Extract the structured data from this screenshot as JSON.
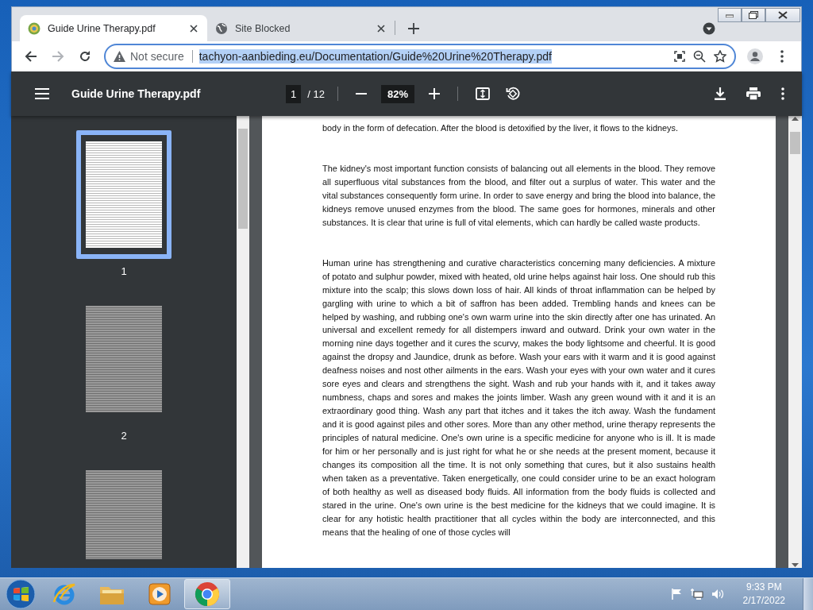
{
  "browser": {
    "tabs": [
      {
        "title": "Guide Urine Therapy.pdf",
        "selected": true
      },
      {
        "title": "Site Blocked",
        "selected": false
      }
    ],
    "address_bar": {
      "security": "Not secure",
      "url": "tachyon-aanbieding.eu/Documentation/Guide%20Urine%20Therapy.pdf",
      "url_selected": true
    }
  },
  "pdf_viewer": {
    "title": "Guide Urine Therapy.pdf",
    "page": "1",
    "page_count": "/ 12",
    "zoom": "82%",
    "thumbnails": [
      {
        "label": "1",
        "selected": true
      },
      {
        "label": "2",
        "selected": false
      },
      {
        "selected": false
      }
    ],
    "paragraphs": [
      "body in the form of defecation. After the blood is detoxified by the liver, it flows to the kidneys.",
      "The kidney's most important function consists of balancing out all elements in the blood. They remove all superfluous vital substances from the blood, and filter out a surplus of water. This water and the vital substances consequently form urine. In order to save energy and bring the blood into balance, the kidneys remove unused enzymes from the blood. The same goes for hormones, minerals and other substances. It is clear that urine is full of vital elements, which can hardly be called waste products.",
      "Human urine has strengthening and curative characteristics concerning many deficiencies. A mixture of potato and sulphur powder, mixed with heated, old urine helps against hair loss. One should rub this mixture into the scalp; this slows down loss of hair. All kinds of throat inflammation can be helped by gargling with urine to which a bit of saffron has been added. Trembling hands and knees can be helped by washing, and rubbing one's own warm urine into the skin directly after one has urinated. An universal and excellent remedy for all distempers inward and outward. Drink your own water in the morning nine days together and it cures the scurvy, makes the body lightsome and cheerful. It is good against the dropsy and Jaundice, drunk as before. Wash your ears with it warm and it is good against deafness noises and nost other ailments in the ears. Wash your eyes with your own water and it cures sore eyes and clears and strengthens the sight. Wash and rub your hands with it, and it takes away numbness, chaps and sores and makes the joints limber. Wash any green wound with it and it is an extraordinary good thing. Wash any part that itches and it takes the itch away. Wash the fundament and it is good against piles and other sores. More than any other method, urine therapy represents the principles of natural medicine. One's own urine is a specific medicine for anyone who is ill. It is made for him or her personally and is just right for what he or she needs at the present moment, because it changes its composition all the time. It is not only something that cures, but it also sustains health when taken as a preventative. Taken energetically, one could consider urine to be an exact hologram of both healthy as well as diseased body fluids. All information from the body fluids is collected and stared in the urine. One's own urine is the best medicine for the kidneys that we could imagine. It is clear for any hotistic health practitioner that all cycles within the body are interconnected, and this means that the healing of one of those cycles will"
    ]
  },
  "taskbar": {
    "apps": [
      {
        "kind": "browser-e",
        "active": false
      },
      {
        "kind": "folder",
        "active": false
      },
      {
        "kind": "media",
        "active": false
      },
      {
        "kind": "chrome",
        "active": true
      }
    ],
    "time": "9:33 PM",
    "date": "2/17/2022"
  }
}
